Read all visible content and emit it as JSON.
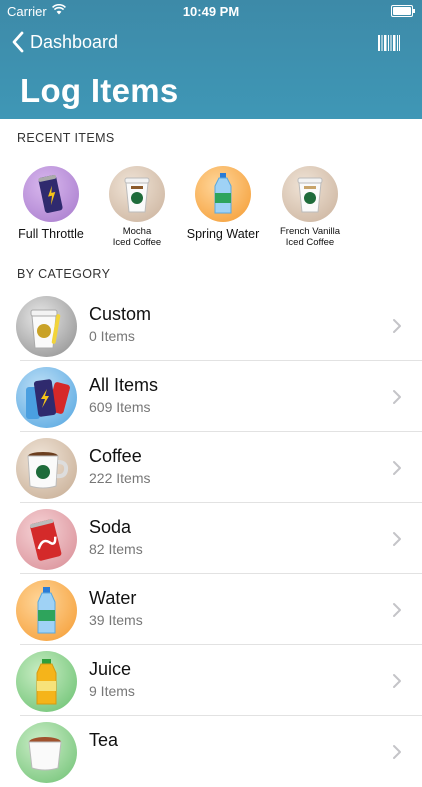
{
  "status": {
    "carrier": "Carrier",
    "time": "10:49 PM"
  },
  "nav": {
    "back_label": "Dashboard",
    "title": "Log Items"
  },
  "recent": {
    "heading": "RECENT ITEMS",
    "items": [
      {
        "label": "Full Throttle"
      },
      {
        "label_line1": "Mocha",
        "label_line2": "Iced Coffee"
      },
      {
        "label": "Spring Water"
      },
      {
        "label_line1": "French Vanilla",
        "label_line2": "Iced Coffee"
      }
    ]
  },
  "category": {
    "heading": "BY CATEGORY",
    "items": [
      {
        "name": "Custom",
        "count": "0 Items"
      },
      {
        "name": "All Items",
        "count": "609 Items"
      },
      {
        "name": "Coffee",
        "count": "222 Items"
      },
      {
        "name": "Soda",
        "count": "82 Items"
      },
      {
        "name": "Water",
        "count": "39 Items"
      },
      {
        "name": "Juice",
        "count": "9 Items"
      },
      {
        "name": "Tea",
        "count": ""
      }
    ]
  }
}
